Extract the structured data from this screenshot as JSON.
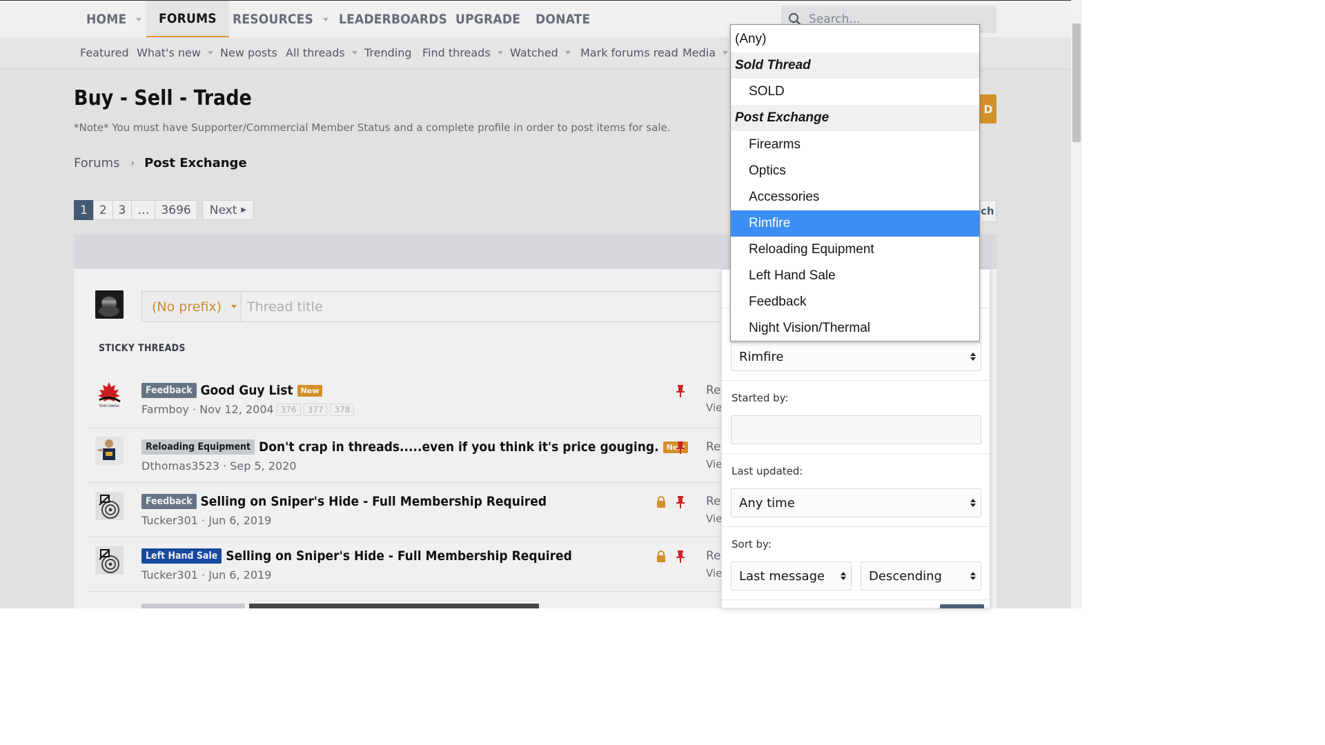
{
  "nav": {
    "tabs": [
      {
        "label": "HOME",
        "dropdown": true
      },
      {
        "label": "FORUMS",
        "active": true
      },
      {
        "label": "RESOURCES",
        "dropdown": true
      },
      {
        "label": "LEADERBOARDS"
      },
      {
        "label": "UPGRADE"
      },
      {
        "label": "DONATE"
      }
    ],
    "search_placeholder": "Search..."
  },
  "subnav": [
    "Featured",
    "What's new",
    "New posts",
    "All threads",
    "Trending",
    "Find threads",
    "Watched",
    "Mark forums read",
    "Media"
  ],
  "page": {
    "title": "Buy - Sell - Trade",
    "note": "*Note* You must have Supporter/Commercial Member Status and a complete profile in order to post items for sale.",
    "breadcrumb": {
      "root": "Forums",
      "current": "Post Exchange"
    },
    "button_peek": "D",
    "filter_peek": "ch"
  },
  "pagination": {
    "pages": [
      "1",
      "2",
      "3",
      "…",
      "3696"
    ],
    "current": "1",
    "next": "Next"
  },
  "new_thread": {
    "prefix": "(No prefix)",
    "title_placeholder": "Thread title"
  },
  "sticky_heading": "STICKY THREADS",
  "threads": [
    {
      "label": "Feedback",
      "label_style": "feedback",
      "title": "Good Guy List",
      "new": "New",
      "author": "Farmboy",
      "date": "Nov 12, 2004",
      "pages": [
        "376",
        "377",
        "378"
      ],
      "locked": false,
      "pinned": true,
      "re": "Re",
      "vi": "Vie"
    },
    {
      "label": "Reloading Equipment",
      "label_style": "reload",
      "title": "Don't crap in threads.....even if you think it's price gouging.",
      "new": "New",
      "author": "Dthomas3523",
      "date": "Sep 5, 2020",
      "pages": [],
      "locked": false,
      "pinned": true,
      "re": "Re",
      "vi": "Vie"
    },
    {
      "label": "Feedback",
      "label_style": "feedback",
      "title": "Selling on Sniper's Hide - Full Membership Required",
      "new": "",
      "author": "Tucker301",
      "date": "Jun 6, 2019",
      "pages": [],
      "locked": true,
      "pinned": true,
      "re": "Re",
      "vi": "Vie"
    },
    {
      "label": "Left Hand Sale",
      "label_style": "lhs",
      "title": "Selling on Sniper's Hide - Full Membership Required",
      "new": "",
      "author": "Tucker301",
      "date": "Jun 6, 2019",
      "pages": [],
      "locked": true,
      "pinned": true,
      "re": "Re",
      "vi": "Vie"
    }
  ],
  "filters": {
    "prefix_selected": "Rimfire",
    "started_by_label": "Started by:",
    "last_updated_label": "Last updated:",
    "last_updated_value": "Any time",
    "sort_by_label": "Sort by:",
    "sort_field": "Last message",
    "sort_order": "Descending"
  },
  "dropdown": {
    "any": "(Any)",
    "groups": [
      {
        "name": "Sold Thread",
        "items": [
          "SOLD"
        ]
      },
      {
        "name": "Post Exchange",
        "items": [
          "Firearms",
          "Optics",
          "Accessories",
          "Rimfire",
          "Reloading Equipment",
          "Left Hand Sale",
          "Feedback",
          "Night Vision/Thermal"
        ]
      }
    ],
    "highlighted": "Rimfire"
  },
  "colors": {
    "accent": "#f19b33",
    "selected": "#3d8ef3",
    "pager_current": "#49607a",
    "pin": "#d9262b",
    "lock": "#e19a2b"
  }
}
